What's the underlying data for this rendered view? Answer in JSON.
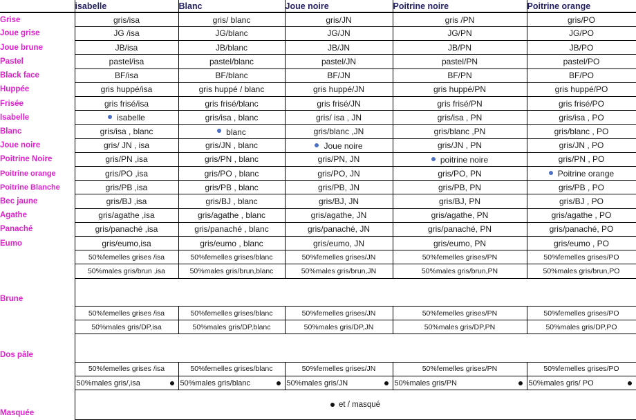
{
  "table": {
    "columns": [
      {
        "key": "isa",
        "label": "isabelle"
      },
      {
        "key": "blanc",
        "label": "Blanc"
      },
      {
        "key": "jn",
        "label": "Joue noire"
      },
      {
        "key": "pn",
        "label": "Poitrine noire"
      },
      {
        "key": "po",
        "label": "Poitrine orange"
      }
    ],
    "rows": [
      {
        "label": "Grise",
        "cells": [
          "gris/isa",
          "gris/ blanc",
          "gris/JN",
          "gris /PN",
          "gris/PO"
        ]
      },
      {
        "label": "Joue grise",
        "cells": [
          "JG /isa",
          "JG/blanc",
          "JG/JN",
          "JG/PN",
          "JG/PO"
        ]
      },
      {
        "label": "Joue brune",
        "cells": [
          "JB/isa",
          "JB/blanc",
          "JB/JN",
          "JB/PN",
          "JB/PO"
        ]
      },
      {
        "label": "Pastel",
        "cells": [
          "pastel/isa",
          "pastel/blanc",
          "pastel/JN",
          "pastel/PN",
          "pastel/PO"
        ]
      },
      {
        "label": "Black face",
        "cells": [
          "BF/isa",
          "BF/blanc",
          "BF/JN",
          "BF/PN",
          "BF/PO"
        ]
      },
      {
        "label": "Huppée",
        "cells": [
          "gris huppé/isa",
          "gris huppé / blanc",
          "gris huppé/JN",
          "gris huppé/PN",
          "gris huppé/PO"
        ]
      },
      {
        "label": "Frisée",
        "cells": [
          "gris frisé/isa",
          "gris frisé/blanc",
          "gris frisé/JN",
          "gris frisé/PN",
          "gris frisé/PO"
        ]
      },
      {
        "label": "Isabelle",
        "cells": [
          "isabelle",
          "gris/isa , blanc",
          "gris/ isa , JN",
          "gris/isa , PN",
          "gris/isa , PO"
        ],
        "self": 0
      },
      {
        "label": "Blanc",
        "cells": [
          "gris/isa , blanc",
          "blanc",
          "gris/blanc ,JN",
          "gris/blanc ,PN",
          "gris/blanc , PO"
        ],
        "self": 1
      },
      {
        "label": "Joue noire",
        "cells": [
          "gris/ JN , isa",
          "gris/JN , blanc",
          "Joue noire",
          "gris/JN , PN",
          "gris/JN , PO"
        ],
        "self": 2
      },
      {
        "label": "Poitrine Noire",
        "cells": [
          "gris/PN ,isa",
          "gris/PN , blanc",
          "gris/PN, JN",
          "poitrine noire",
          "gris/PN , PO"
        ],
        "self": 3
      },
      {
        "label": "Poitrine orange",
        "cells": [
          "gris/PO ,isa",
          "gris/PO , blanc",
          "gris/PO, JN",
          "gris/PO, PN",
          "Poitrine orange"
        ],
        "self": 4
      },
      {
        "label": "Poitrine Blanche",
        "cells": [
          "gris/PB ,isa",
          "gris/PB , blanc",
          "gris/PB, JN",
          "gris/PB, PN",
          "gris/PB , PO"
        ]
      },
      {
        "label": "Bec jaune",
        "cells": [
          "gris/BJ ,isa",
          "gris/BJ , blanc",
          "gris/BJ, JN",
          "gris/BJ, PN",
          "gris/BJ , PO"
        ]
      },
      {
        "label": "Agathe",
        "cells": [
          "gris/agathe ,isa",
          "gris/agathe , blanc",
          "gris/agathe, JN",
          "gris/agathe, PN",
          "gris/agathe , PO"
        ]
      },
      {
        "label": "Panaché",
        "cells": [
          "gris/panaché ,isa",
          "gris/panaché , blanc",
          "gris/panaché, JN",
          "gris/panaché, PN",
          "gris/panaché, PO"
        ]
      },
      {
        "label": "Eumo",
        "cells": [
          "gris/eumo,isa",
          "gris/eumo , blanc",
          "gris/eumo, JN",
          "gris/eumo, PN",
          "gris/eumo , PO"
        ]
      }
    ],
    "groups": [
      {
        "label": "Brune",
        "lines": [
          {
            "cells": [
              "50%femelles grises /isa",
              "50%femelles grises/blanc",
              "50%femelles grises/JN",
              "50%femelles grises/PN",
              "50%femelles grises/PO"
            ],
            "dot": false
          },
          {
            "cells": [
              "50%males gris/brun ,isa",
              "50%males gris/brun,blanc",
              "50%males gris/brun,JN",
              "50%males gris/brun,PN",
              "50%males gris/brun,PO"
            ],
            "dot": false
          }
        ]
      },
      {
        "label": "Dos pâle",
        "lines": [
          {
            "cells": [
              "50%femelles grises /isa",
              "50%femelles grises/blanc",
              "50%femelles grises/JN",
              "50%femelles grises/PN",
              "50%femelles grises/PO"
            ],
            "dot": false
          },
          {
            "cells": [
              "50%males gris/DP,isa",
              "50%males gris/DP,blanc",
              "50%males gris/DP,JN",
              "50%males gris/DP,PN",
              "50%males gris/DP,PO"
            ],
            "dot": false
          }
        ]
      },
      {
        "label": "Masquée",
        "lines": [
          {
            "cells": [
              "50%femelles grises /isa",
              "50%femelles grises/blanc",
              "50%femelles grises/JN",
              "50%femelles grises/PN",
              "50%femelles grises/PO"
            ],
            "dot": false
          },
          {
            "cells": [
              "50%males gris/,isa",
              "50%males gris/blanc",
              "50%males gris/JN",
              "50%males gris/PN",
              "50%males gris/ PO"
            ],
            "dot": true
          }
        ]
      }
    ],
    "legend": "et / masqué",
    "colors": {
      "row_label": "#e01fd0",
      "header": "#232067",
      "self_dot": "#4a6fc4",
      "mask_dot": "#111111",
      "grid_line": "#000000"
    }
  }
}
